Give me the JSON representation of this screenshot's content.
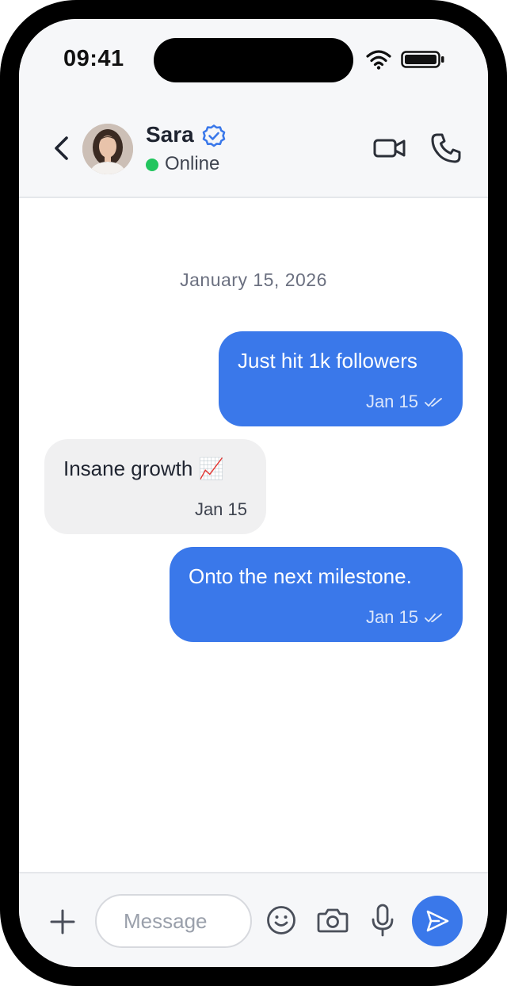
{
  "status_bar": {
    "time": "09:41",
    "icons": [
      "wifi-icon",
      "battery-icon"
    ]
  },
  "header": {
    "back_icon": "chevron-left-icon",
    "contact_name": "Sara",
    "verified_icon": "verified-badge-icon",
    "status_text": "Online",
    "actions": [
      "video-call-icon",
      "phone-call-icon"
    ]
  },
  "chat": {
    "date_separator": "January 15, 2026",
    "messages": [
      {
        "direction": "outgoing",
        "text": "Just hit 1k followers",
        "time": "Jan 15",
        "read": true
      },
      {
        "direction": "incoming",
        "text": "Insane growth 📈",
        "time": "Jan 15"
      },
      {
        "direction": "outgoing",
        "text": "Onto the next milestone.",
        "time": "Jan 15",
        "read": true
      }
    ]
  },
  "composer": {
    "placeholder": "Message",
    "value": "",
    "icons": [
      "plus-icon",
      "emoji-icon",
      "camera-icon",
      "microphone-icon",
      "send-icon"
    ]
  },
  "colors": {
    "accent": "#3a78ea",
    "online": "#22c55e",
    "incoming_bubble": "#f0f0f1",
    "header_bg": "#f6f7f9"
  }
}
